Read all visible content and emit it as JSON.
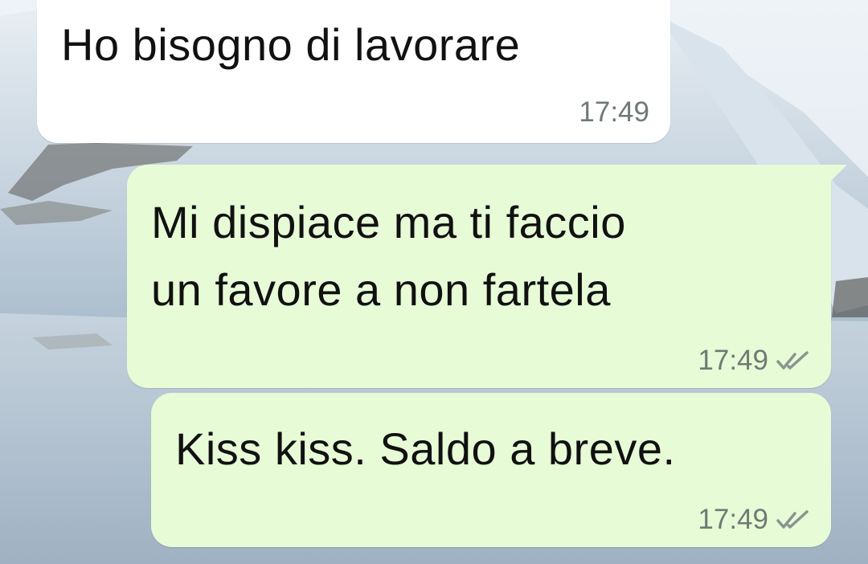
{
  "chat": {
    "messages": [
      {
        "direction": "incoming",
        "text": "Ho bisogno di lavorare",
        "time": "17:49"
      },
      {
        "direction": "outgoing",
        "text": "Mi dispiace ma ti faccio\nun favore a non fartela",
        "time": "17:49",
        "status_icon": "double-check-icon"
      },
      {
        "direction": "outgoing",
        "text": "Kiss kiss. Saldo a breve.",
        "time": "17:49",
        "status_icon": "double-check-icon"
      }
    ]
  },
  "colors": {
    "incoming_bubble": "#ffffff",
    "outgoing_bubble": "#e7fcd6",
    "timestamp": "#6f7a74",
    "text": "#111111"
  }
}
